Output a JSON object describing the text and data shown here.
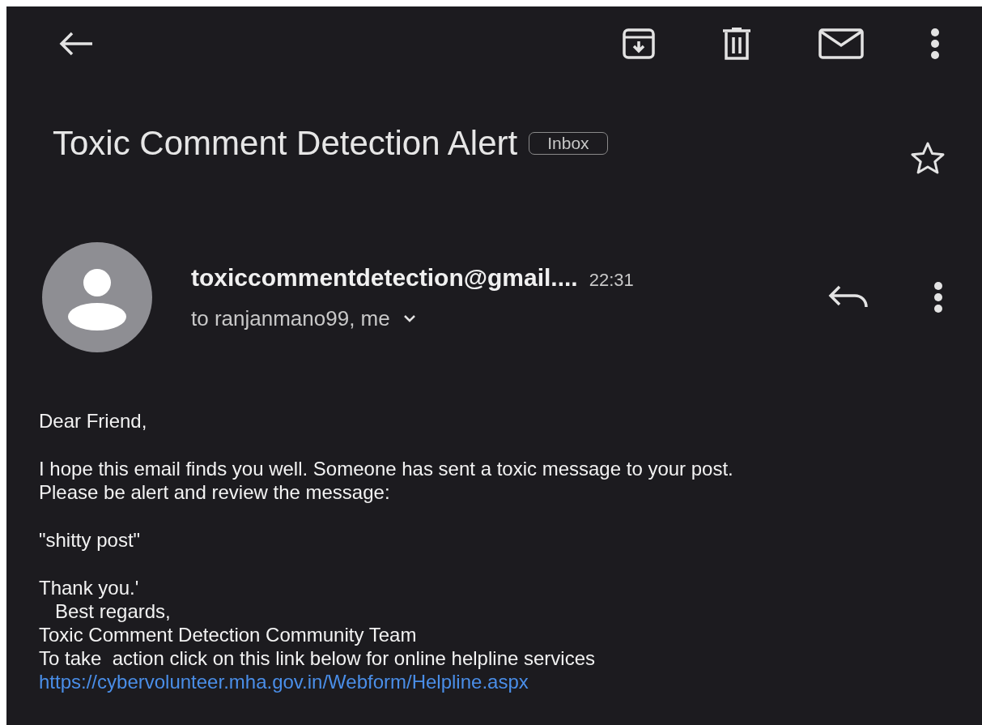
{
  "subject": {
    "title": "Toxic Comment Detection Alert",
    "label": "Inbox",
    "starred": false
  },
  "message": {
    "sender": "toxiccommentdetection@gmail....",
    "time": "22:31",
    "recipients": "to ranjanmano99, me"
  },
  "body": [
    [
      {
        "kind": "text",
        "text": "Dear Friend,"
      }
    ],
    [
      {
        "kind": "text",
        "text": "I hope this email finds you well. Someone has sent a toxic message to your post."
      },
      {
        "kind": "text",
        "text": "Please be alert and review the message:"
      }
    ],
    [
      {
        "kind": "text",
        "text": "\"shitty post\""
      }
    ],
    [
      {
        "kind": "text",
        "text": "Thank you.'"
      },
      {
        "kind": "text",
        "text": "   Best regards,"
      },
      {
        "kind": "text",
        "text": "Toxic Comment Detection Community Team"
      },
      {
        "kind": "text",
        "text": "To take  action click on this link below for online helpline services"
      },
      {
        "kind": "link",
        "text": "https://cybervolunteer.mha.gov.in/Webform/Helpline.aspx"
      }
    ]
  ]
}
